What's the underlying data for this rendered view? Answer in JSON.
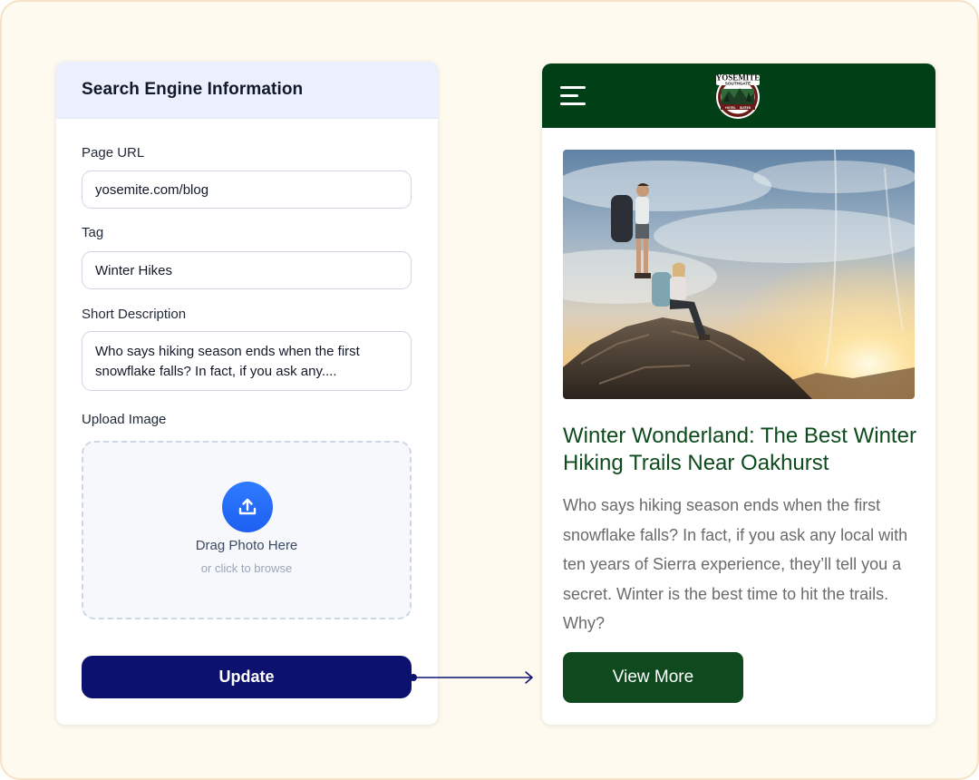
{
  "form": {
    "title": "Search Engine Information",
    "page_url_label": "Page URL",
    "page_url_value": "yosemite.com/blog",
    "tag_label": "Tag",
    "tag_value": "Winter Hikes",
    "short_description_label": "Short Description",
    "short_description_value": "Who says hiking season ends when the first snowflake falls? In fact, if you ask any....",
    "upload_label": "Upload Image",
    "upload_title": "Drag Photo Here",
    "upload_subtitle": "or click to browse",
    "upload_icon": "upload-icon",
    "update_label": "Update"
  },
  "preview": {
    "menu_icon": "hamburger-menu-icon",
    "logo_text_top": "YOSEMITE",
    "logo_text_sub": "SOUTHGATE",
    "logo_text_left": "HOTEL",
    "logo_text_right": "SUITES",
    "post_title": "Winter Wonderland: The Best Winter Hiking Trails Near Oakhurst",
    "post_body": "Who says hiking season ends when the first snowflake falls? In fact, if you ask any local with ten years of Sierra experience, they’ll tell you a secret. Winter is the best time to hit the trails. Why?",
    "view_more_label": "View More"
  },
  "colors": {
    "frame_bg": "#fefaf0",
    "form_header_bg": "#eceffe",
    "update_button": "#0c1170",
    "upload_icon_bg": "#2f7bff",
    "nav_bg": "#013f17",
    "post_title": "#0d4a1c",
    "view_more_button": "#0f4a1f"
  }
}
